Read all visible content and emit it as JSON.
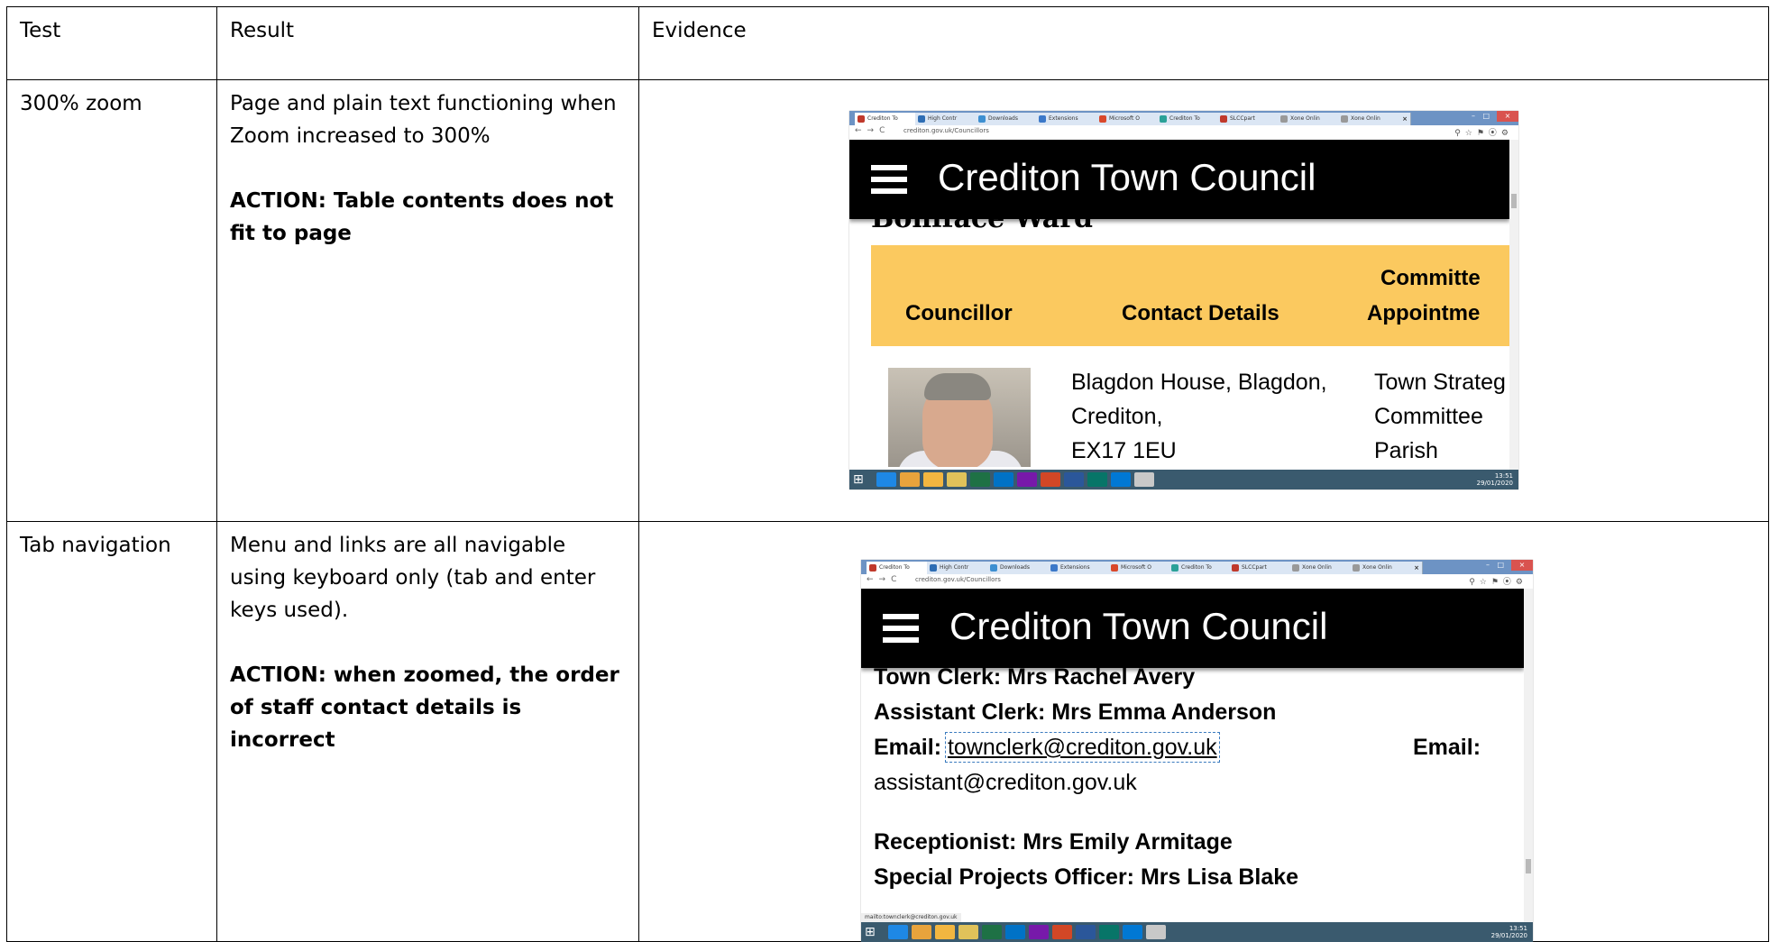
{
  "table": {
    "headers": [
      "Test",
      "Result",
      "Evidence"
    ],
    "rows": [
      {
        "test": "300% zoom",
        "result": "Page and plain text functioning when Zoom increased to 300%",
        "action": "ACTION: Table contents does not fit to page"
      },
      {
        "test": "Tab navigation",
        "result": "Menu and links are all navigable using keyboard only (tab and enter keys used).",
        "action": "ACTION: when zoomed, the order of staff contact details is incorrect"
      }
    ]
  },
  "screenshots": {
    "tabs": [
      "Crediton To",
      "High Contr",
      "Downloads",
      "Extensions",
      "Microsoft O",
      "Crediton To",
      "SLCCpart",
      "Xone Onlin",
      "Xone Onlin"
    ],
    "tab_colors": [
      "#c0392b",
      "#2e6db4",
      "#3d8fd1",
      "#3b78c9",
      "#d9482b",
      "#2aa198",
      "#c0392b",
      "#999999",
      "#999999"
    ],
    "url": "crediton.gov.uk/Councillors",
    "site_title": "Crediton Town Council",
    "zoom": {
      "cut_heading": "Boniface Ward",
      "columns": [
        "Councillor",
        "Contact Details",
        "Committee Appointme"
      ],
      "column_line1": "Committe",
      "column_line2": "Appointme",
      "contact_lines": [
        "Blagdon House, Blagdon,",
        "Crediton,",
        "EX17 1EU"
      ],
      "appointment_lines": [
        "Town Strateg",
        "Committee",
        "Parish"
      ]
    },
    "tabnav": {
      "town_clerk": "Town Clerk: Mrs Rachel Avery",
      "assistant_clerk": "Assistant Clerk: Mrs Emma Anderson",
      "email_label": "Email:",
      "email_clerk": "townclerk@crediton.gov.uk",
      "email_label2": "Email:",
      "email_assistant": "assistant@crediton.gov.uk",
      "receptionist": "Receptionist: Mrs Emily Armitage",
      "special_projects": "Special Projects Officer: Mrs Lisa Blake",
      "status_url": "mailto:townclerk@crediton.gov.uk"
    },
    "clock_1": "13:51",
    "date_1": "29/01/2020",
    "clock_2": "13:51",
    "date_2": "29/01/2020",
    "header_color": "#000000",
    "table_header_color": "#fbc95f"
  }
}
